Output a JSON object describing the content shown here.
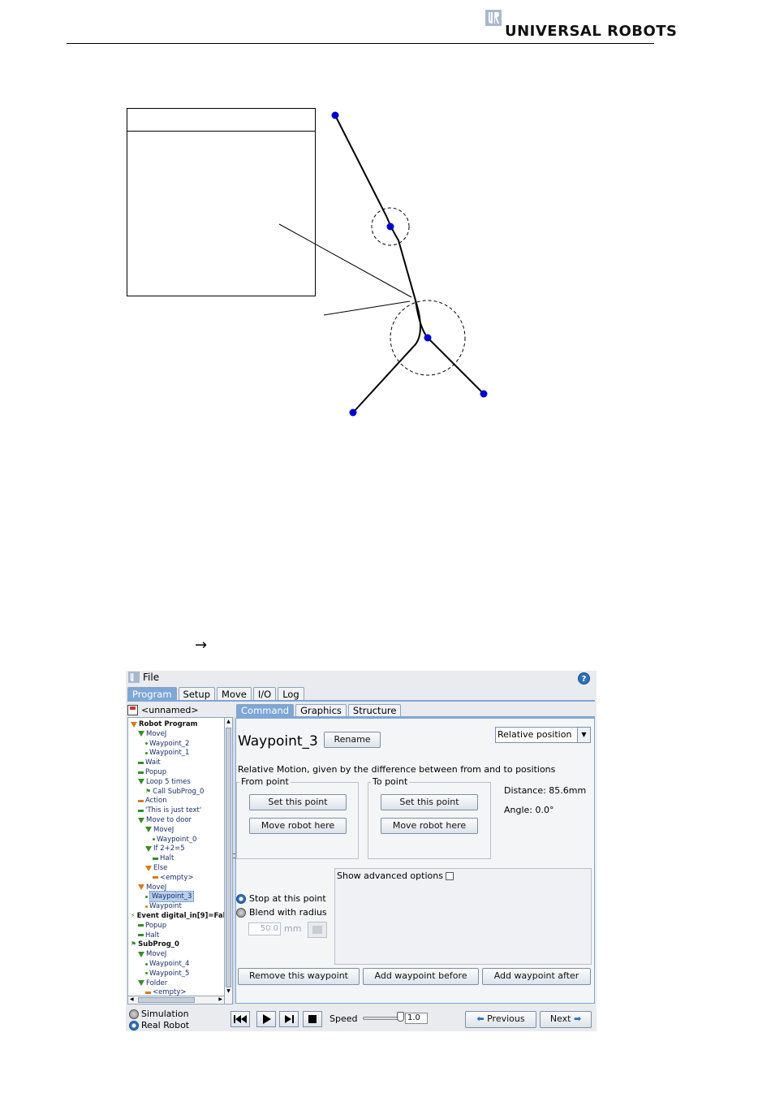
{
  "header": {
    "brand": "UNIVERSAL ROBOTS"
  },
  "figure": {
    "arrow": "→"
  },
  "ur": {
    "file_menu": "File",
    "help_glyph": "?",
    "main_tabs": [
      "Program",
      "Setup",
      "Move",
      "I/O",
      "Log"
    ],
    "program_name": "<unnamed>",
    "tree": [
      {
        "label": "Robot Program",
        "icon": "triangle-orange",
        "indent": 0,
        "bold": true
      },
      {
        "label": "MoveJ",
        "icon": "triangle-green",
        "indent": 1
      },
      {
        "label": "Waypoint_2",
        "icon": "dot-green",
        "indent": 2
      },
      {
        "label": "Waypoint_1",
        "icon": "dot-green",
        "indent": 2
      },
      {
        "label": "Wait",
        "icon": "dash-green",
        "indent": 1
      },
      {
        "label": "Popup",
        "icon": "dash-green",
        "indent": 1
      },
      {
        "label": "Loop 5 times",
        "icon": "triangle-green",
        "indent": 1
      },
      {
        "label": "Call SubProg_0",
        "icon": "flag-green",
        "indent": 2
      },
      {
        "label": "Action",
        "icon": "dash-orange",
        "indent": 1
      },
      {
        "label": "'This is just text'",
        "icon": "dash-green",
        "indent": 1
      },
      {
        "label": "Move to door",
        "icon": "triangle-green",
        "indent": 1
      },
      {
        "label": "MoveJ",
        "icon": "triangle-green",
        "indent": 2
      },
      {
        "label": "Waypoint_0",
        "icon": "dot-green",
        "indent": 3
      },
      {
        "label": "If 2+2=5",
        "icon": "triangle-green",
        "indent": 2
      },
      {
        "label": "Halt",
        "icon": "dash-green",
        "indent": 3
      },
      {
        "label": "Else",
        "icon": "triangle-orange",
        "indent": 2
      },
      {
        "label": "<empty>",
        "icon": "dash-orange",
        "indent": 3
      },
      {
        "label": "MoveJ",
        "icon": "triangle-orange",
        "indent": 1
      },
      {
        "label": "Waypoint_3",
        "icon": "dot-green",
        "indent": 2,
        "selected": true
      },
      {
        "label": "Waypoint",
        "icon": "dot-orange",
        "indent": 2
      },
      {
        "label": "Event digital_in[9]=Fals",
        "icon": "event-green",
        "indent": 0,
        "bold": true
      },
      {
        "label": "Popup",
        "icon": "dash-green",
        "indent": 1
      },
      {
        "label": "Halt",
        "icon": "dash-green",
        "indent": 1
      },
      {
        "label": "SubProg_0",
        "icon": "flag-green",
        "indent": 0,
        "bold": true
      },
      {
        "label": "MoveJ",
        "icon": "triangle-green",
        "indent": 1
      },
      {
        "label": "Waypoint_4",
        "icon": "dot-green",
        "indent": 2
      },
      {
        "label": "Waypoint_5",
        "icon": "dot-green",
        "indent": 2
      },
      {
        "label": "Folder",
        "icon": "triangle-green",
        "indent": 1
      },
      {
        "label": "<empty>",
        "icon": "dash-orange",
        "indent": 2
      }
    ],
    "sub_tabs": [
      "Command",
      "Graphics",
      "Structure"
    ],
    "waypoint": {
      "title": "Waypoint_3",
      "rename": "Rename",
      "position_mode": "Relative position",
      "description": "Relative Motion, given by the difference between from and to positions",
      "from_label": "From point",
      "to_label": "To point",
      "set_point": "Set this point",
      "move_here": "Move robot here",
      "distance": "Distance: 85.6mm",
      "angle": "Angle: 0.0°",
      "advanced": "Show advanced options",
      "stop_option": "Stop at this point",
      "blend_option": "Blend with radius",
      "blend_value": "50.0",
      "blend_unit": "mm",
      "remove": "Remove this waypoint",
      "add_before": "Add waypoint before",
      "add_after": "Add waypoint after"
    },
    "bottom": {
      "simulation": "Simulation",
      "real_robot": "Real Robot",
      "speed_label": "Speed",
      "speed_value": "1.0",
      "previous": "Previous",
      "next": "Next"
    }
  }
}
